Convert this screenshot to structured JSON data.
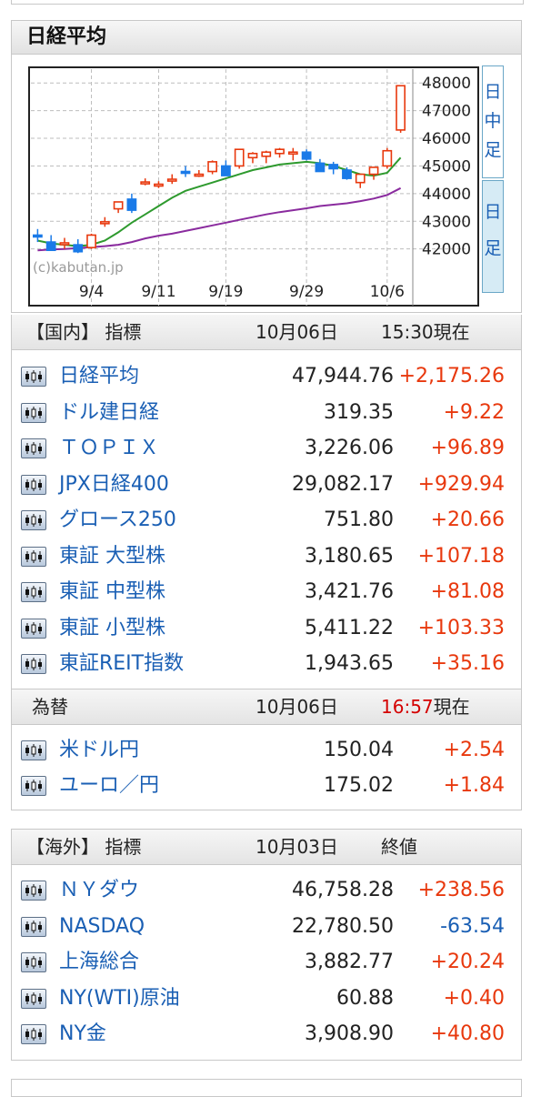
{
  "nikkei_panel": {
    "title": "日経平均",
    "tabs": [
      "日\n中\n足",
      "日\n足"
    ],
    "chart_data": {
      "type": "candlestick",
      "watermark": "(c)kabutan.jp",
      "x_tick_labels": [
        "9/4",
        "9/11",
        "9/19",
        "9/29",
        "10/6"
      ],
      "y_tick_labels": [
        "48000",
        "47000",
        "46000",
        "45000",
        "44000",
        "43000",
        "42000"
      ],
      "ylim": [
        41200,
        48500
      ],
      "grid": true,
      "candles": [
        {
          "o": 42500,
          "h": 42720,
          "l": 42250,
          "c": 42480
        },
        {
          "o": 42250,
          "h": 42500,
          "l": 42000,
          "c": 41950
        },
        {
          "o": 42200,
          "h": 42400,
          "l": 42000,
          "c": 42220
        },
        {
          "o": 42150,
          "h": 42350,
          "l": 41850,
          "c": 41900
        },
        {
          "o": 42050,
          "h": 42550,
          "l": 42000,
          "c": 42500
        },
        {
          "o": 42950,
          "h": 43150,
          "l": 42800,
          "c": 42980
        },
        {
          "o": 43450,
          "h": 43700,
          "l": 43300,
          "c": 43700
        },
        {
          "o": 43800,
          "h": 44000,
          "l": 43300,
          "c": 43400
        },
        {
          "o": 44400,
          "h": 44550,
          "l": 44300,
          "c": 44420
        },
        {
          "o": 44300,
          "h": 44450,
          "l": 44200,
          "c": 44340
        },
        {
          "o": 44500,
          "h": 44700,
          "l": 44350,
          "c": 44520
        },
        {
          "o": 44800,
          "h": 45000,
          "l": 44600,
          "c": 44750
        },
        {
          "o": 44700,
          "h": 44850,
          "l": 44600,
          "c": 44700
        },
        {
          "o": 44800,
          "h": 45200,
          "l": 44700,
          "c": 45150
        },
        {
          "o": 45000,
          "h": 45200,
          "l": 44700,
          "c": 44650
        },
        {
          "o": 45000,
          "h": 45600,
          "l": 44900,
          "c": 45600
        },
        {
          "o": 45300,
          "h": 45500,
          "l": 45100,
          "c": 45450
        },
        {
          "o": 45350,
          "h": 45550,
          "l": 45100,
          "c": 45500
        },
        {
          "o": 45450,
          "h": 45650,
          "l": 45300,
          "c": 45600
        },
        {
          "o": 45450,
          "h": 45650,
          "l": 45200,
          "c": 45500
        },
        {
          "o": 45500,
          "h": 45600,
          "l": 45200,
          "c": 45250
        },
        {
          "o": 45100,
          "h": 45250,
          "l": 44800,
          "c": 44800
        },
        {
          "o": 45050,
          "h": 45150,
          "l": 44700,
          "c": 44900
        },
        {
          "o": 44850,
          "h": 44950,
          "l": 44500,
          "c": 44550
        },
        {
          "o": 44400,
          "h": 44700,
          "l": 44200,
          "c": 44700
        },
        {
          "o": 44700,
          "h": 44900,
          "l": 44500,
          "c": 44950
        },
        {
          "o": 45000,
          "h": 45650,
          "l": 44900,
          "c": 45550
        },
        {
          "o": 46300,
          "h": 47900,
          "l": 46200,
          "c": 47900
        }
      ],
      "series": [
        {
          "values": [
            42300,
            42200,
            42150,
            42100,
            42150,
            42300,
            42600,
            42950,
            43250,
            43550,
            43850,
            44100,
            44250,
            44400,
            44550,
            44700,
            44850,
            44950,
            45050,
            45100,
            45150,
            45100,
            45000,
            44850,
            44700,
            44650,
            44750,
            45300
          ]
        },
        {
          "values": [
            41950,
            41980,
            42000,
            42030,
            42060,
            42100,
            42150,
            42250,
            42380,
            42480,
            42550,
            42650,
            42750,
            42850,
            42950,
            43050,
            43150,
            43250,
            43330,
            43400,
            43470,
            43550,
            43600,
            43650,
            43730,
            43820,
            43950,
            44200
          ]
        }
      ],
      "candle_up_color": "#e8380d",
      "candle_down_color": "#1a7ae8",
      "ma_colors": [
        "#2e9a2e",
        "#8a2b9e"
      ]
    }
  },
  "domestic": {
    "header": {
      "label": "【国内】 指標",
      "date": "10月06日",
      "time": "15:30現在"
    },
    "rows": [
      {
        "name": "日経平均",
        "price": "47,944.76",
        "change": "+2,175.26"
      },
      {
        "name": "ドル建日経",
        "price": "319.35",
        "change": "+9.22"
      },
      {
        "name": "ＴＯＰＩＸ",
        "price": "3,226.06",
        "change": "+96.89"
      },
      {
        "name": "JPX日経400",
        "price": "29,082.17",
        "change": "+929.94"
      },
      {
        "name": "グロース250",
        "price": "751.80",
        "change": "+20.66"
      },
      {
        "name": "東証 大型株",
        "price": "3,180.65",
        "change": "+107.18"
      },
      {
        "name": "東証 中型株",
        "price": "3,421.76",
        "change": "+81.08"
      },
      {
        "name": "東証 小型株",
        "price": "5,411.22",
        "change": "+103.33"
      },
      {
        "name": "東証REIT指数",
        "price": "1,943.65",
        "change": "+35.16"
      }
    ]
  },
  "fx": {
    "header": {
      "label": "為替",
      "date": "10月06日",
      "time_hm": "16:57",
      "time_suffix": "現在"
    },
    "rows": [
      {
        "name": "米ドル円",
        "price": "150.04",
        "change": "+2.54"
      },
      {
        "name": "ユーロ／円",
        "price": "175.02",
        "change": "+1.84"
      }
    ]
  },
  "overseas": {
    "header": {
      "label": "【海外】 指標",
      "date": "10月03日",
      "time": "終値"
    },
    "rows": [
      {
        "name": "ＮＹダウ",
        "price": "46,758.28",
        "change": "+238.56",
        "dir": "up"
      },
      {
        "name": "NASDAQ",
        "price": "22,780.50",
        "change": "-63.54",
        "dir": "down"
      },
      {
        "name": "上海総合",
        "price": "3,882.77",
        "change": "+20.24",
        "dir": "up"
      },
      {
        "name": "NY(WTI)原油",
        "price": "60.88",
        "change": "+0.40",
        "dir": "up"
      },
      {
        "name": "NY金",
        "price": "3,908.90",
        "change": "+40.80",
        "dir": "up"
      }
    ]
  },
  "icons": {
    "row_icon": "candlestick-chart-icon"
  },
  "colors": {
    "up": "#e8380d",
    "down": "#1a5fb4",
    "link": "#1a5fb4",
    "time_highlight": "#d40000"
  }
}
